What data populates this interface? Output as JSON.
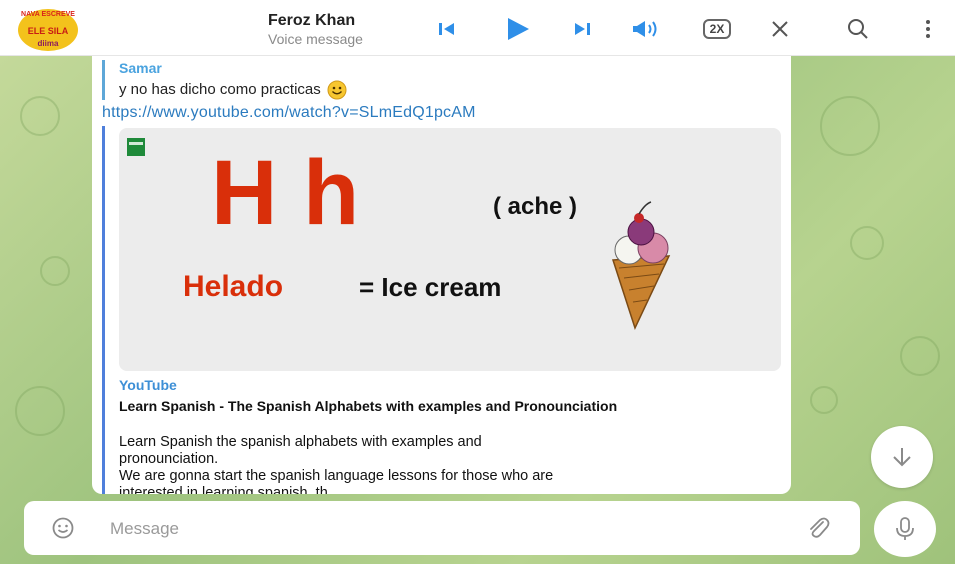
{
  "player": {
    "name": "Feroz Khan",
    "subtitle": "Voice message",
    "speed": "2X",
    "avatar_text_top": "NAVA ESCREVE",
    "avatar_text_mid": "ELE SILA",
    "avatar_text_bottom": "diima"
  },
  "message": {
    "reply_name": "Samar",
    "reply_text": "y no has dicho como practicas",
    "link": "https://www.youtube.com/watch?v=SLmEdQ1pcAM",
    "preview": {
      "site": "YouTube",
      "title": "Learn Spanish - The Spanish Alphabets with examples and Pronounciation",
      "desc_line1": "Learn Spanish the spanish alphabets with examples and",
      "desc_line2": "pronounciation.",
      "desc_line3": "We are gonna start the spanish language lessons for those who are",
      "desc_line4": "interested in learning spanish, th",
      "thumb": {
        "big_letters": "H h",
        "pronunciation": "( ache )",
        "word": "Helado",
        "meaning": "= Ice cream"
      }
    }
  },
  "composer": {
    "placeholder": "Message"
  },
  "colors": {
    "accent_blue": "#2f8fe8",
    "link": "#2b7bbf",
    "letter_red": "#d92f0a",
    "chat_green": "#a9c987"
  },
  "icons": [
    "skip-previous-icon",
    "play-icon",
    "skip-next-icon",
    "volume-icon",
    "close-icon",
    "search-icon",
    "more-vertical-icon",
    "smile-emoji-icon",
    "emoji-icon",
    "paperclip-icon",
    "microphone-icon",
    "arrow-down-icon",
    "ice-cream-icon"
  ]
}
